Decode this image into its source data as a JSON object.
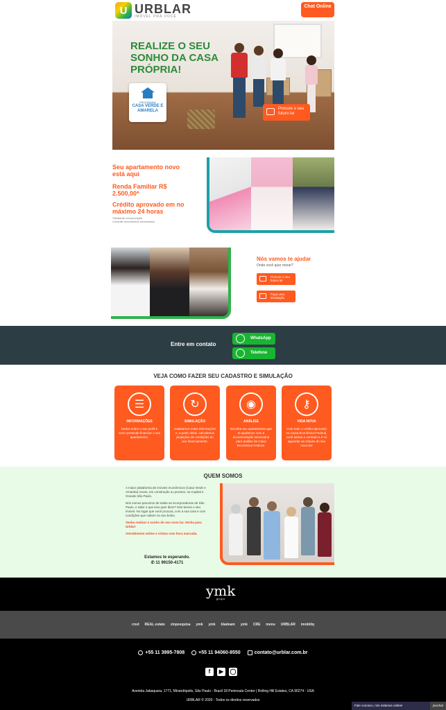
{
  "header": {
    "logo_name": "URBLAR",
    "logo_tagline": "IMÓVEL PRA VOCÊ",
    "chat_label": "Chat Online"
  },
  "hero": {
    "headline": "REALIZE O SEU SONHO DA CASA PRÓPRIA!",
    "program_small": "PROGRAMA",
    "program_name": "CASA VERDE E AMARELA",
    "cta": "Procure o seu futuro lar"
  },
  "offer": {
    "line1": "Seu apartamento novo está aqui",
    "line2": "Renda Familiar R$ 2.500,00*",
    "line3": "Crédito aprovado em no máximo 24 horas",
    "note1": "*Mediante comprovação",
    "note2": "Consulte documentos necessários"
  },
  "help": {
    "title": "Nós vamos te ajudar",
    "subtitle": "Onde você quer morar?",
    "btn_search": "Procure o seu futuro lar",
    "btn_simulate": "Faça uma simulação"
  },
  "contact": {
    "label": "Entre em contato",
    "whatsapp": "WhatsApp",
    "phone": "Telefone"
  },
  "steps": {
    "title": "VEJA COMO FAZER SEU CADASTRO E SIMULAÇÃO",
    "items": [
      {
        "title": "INFORMAÇÕES",
        "desc": "Dados sobre o seu perfil e como pretende financiar o seu apartamento."
      },
      {
        "title": "SIMULAÇÃO",
        "desc": "Analisamos estas informações e, a partir delas, calculamos projeções de condições do seu financiamento."
      },
      {
        "title": "ANÁLISE",
        "desc": "Escolha seu apartamento que te ajudamos com a documentação necessária para análise da Caixa Econômica Federal."
      },
      {
        "title": "VIDA NOVA",
        "desc": "Com todo o crédito aprovado na Caixa Econômica Federal, você assina o contrato e é só aguardar as chaves do seu novo lar!"
      }
    ]
  },
  "about": {
    "title": "QUEM SOMOS",
    "p1": "A maior plataforma de imóveis econômicos (Casa Verde e Amarela) novos, em construção ou prontos, na Capital e Grande São Paulo.",
    "p2": "Nós somos parceiros de todas as incorporadoras de São Paulo, e sabe o que isso quer dizer? Nós temos o seu imóvel. No lugar que você procura, com a sua cara e com condições que cabem no seu bolso.",
    "p3": "Venha realizar o sonho do seu novo lar. Venha para Urblar!",
    "p4": "Atendimento online e visitas com hora marcada.",
    "waiting": "Estamos te esperando.",
    "phone": "11 99150-4171"
  },
  "footer": {
    "group_logo": "ymk",
    "group_word": "grupo",
    "brands": [
      "cred",
      "REAL estate",
      "zinpesquisa",
      "ymk",
      "ymk",
      "bladeam",
      "ymk",
      "CRE",
      "menu",
      "URBLAR",
      "imobiliq"
    ],
    "phone1": "+55 11 3995-7808",
    "phone2": "+55 11 94060-8550",
    "email": "contato@urblar.com.br",
    "address": "Avenida Jabaquara, 1771, Mirandópolis, São Paulo - Brazil 18 Peninsula Center | Rolling Hill Estates, CA 90274 - USA",
    "copyright": "URBLAR © 2020 - Todos os direitos reservados"
  },
  "chatbar": {
    "text": "Fale conosco, nós estamos online!",
    "brand": "jivochat"
  },
  "colors": {
    "accent": "#ff5a1f",
    "green": "#2e8a3a",
    "whatsapp": "#18b531",
    "band": "#2c3d44",
    "about_bg": "#e8fbe6"
  }
}
